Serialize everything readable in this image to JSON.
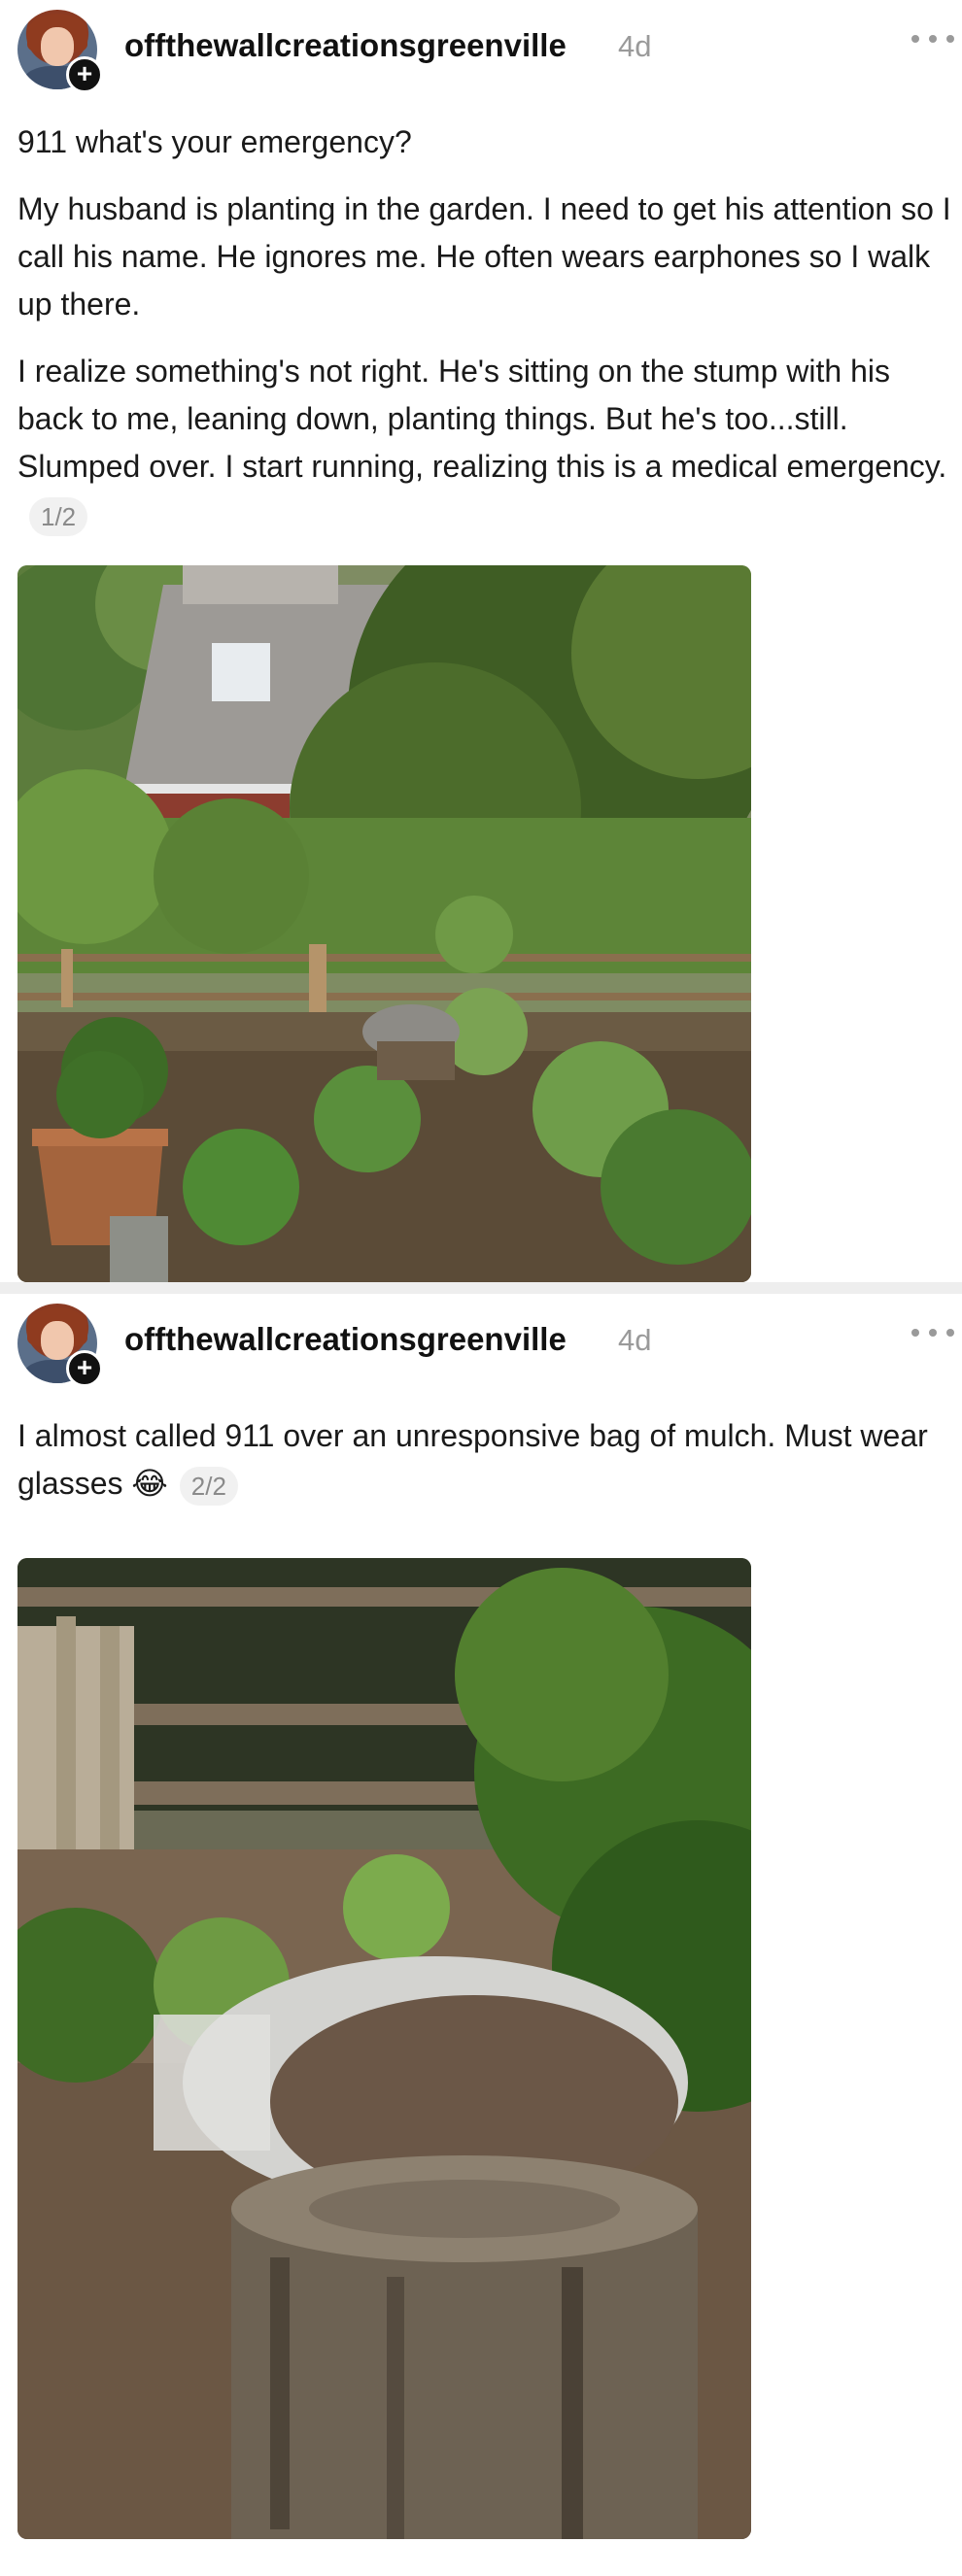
{
  "posts": [
    {
      "username": "offthewallcreationsgreenville",
      "time": "4d",
      "title": "911 what's your emergency?",
      "paragraphs": [
        "My husband is planting in the garden. I need to get his attention so I call his name. He ignores me. He often wears earphones so I walk up there.",
        "I realize something's not right. He's sitting on the stump with his back to me, leaning down, planting things. But he's too...still. Slumped over. I start running, realizing this is a medical emergency."
      ],
      "pager": "1/2",
      "icons": {
        "avatar": "avatar-icon",
        "follow": "plus-icon",
        "more": "more-icon"
      }
    },
    {
      "username": "offthewallcreationsgreenville",
      "time": "4d",
      "paragraphs": [
        "I almost called 911 over an unresponsive bag of mulch. Must wear glasses 😂"
      ],
      "pager": "2/2",
      "icons": {
        "avatar": "avatar-icon",
        "follow": "plus-icon",
        "more": "more-icon"
      }
    }
  ],
  "colors": {
    "text": "#1a1a1a",
    "muted": "#9a9a9a",
    "pager_bg": "#f1f1f1",
    "divider": "#eeeeee"
  }
}
